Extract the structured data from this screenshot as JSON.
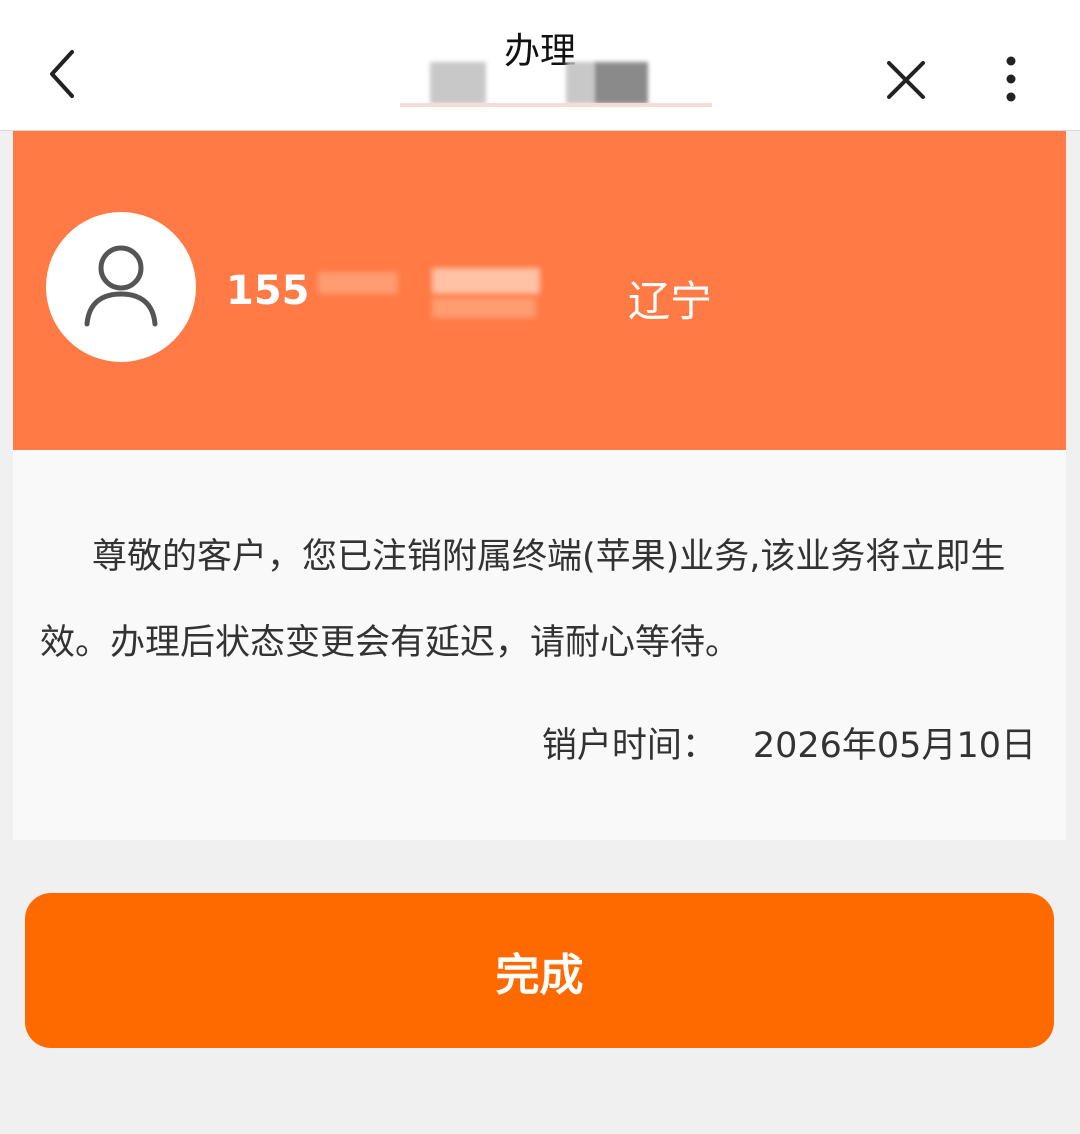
{
  "header": {
    "title": "办理",
    "back_icon": "chevron-left-icon",
    "close_icon": "close-icon",
    "more_icon": "more-vertical-icon"
  },
  "user": {
    "phone_prefix": "155",
    "province": "辽宁",
    "avatar_icon": "user-icon"
  },
  "message": {
    "body": "尊敬的客户，您已注销附属终端(苹果)业务,该业务将立即生效。办理后状态变更会有延迟，请耐心等待。",
    "time_label": "销户时间：",
    "time_value": "2026年05月10日"
  },
  "actions": {
    "done_label": "完成"
  },
  "colors": {
    "banner": "#ff7a45",
    "button": "#ff6a00",
    "page_bg": "#f0f0f0",
    "card_bg": "#f9f9f9"
  }
}
